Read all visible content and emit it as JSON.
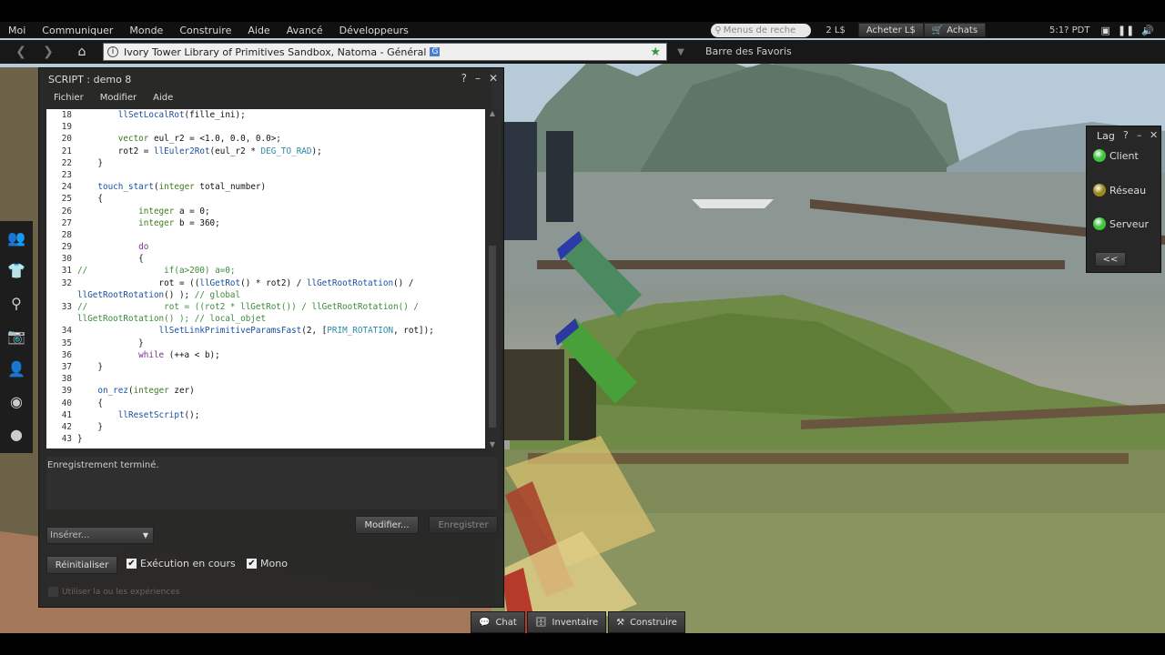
{
  "menubar": {
    "items": [
      "Moi",
      "Communiquer",
      "Monde",
      "Construire",
      "Aide",
      "Avancé",
      "Développeurs"
    ],
    "search_placeholder": "Menus de reche",
    "balance": "2 L$",
    "buy_button": "Acheter L$",
    "shop_button": "Achats",
    "clock": "5:1? PDT"
  },
  "navbar": {
    "location": "Ivory Tower Library of Primitives Sandbox, Natoma - Général",
    "favorites_label": "Barre des Favoris"
  },
  "script_window": {
    "title": "SCRIPT : demo 8",
    "menu": [
      "Fichier",
      "Modifier",
      "Aide"
    ],
    "code_lines": [
      {
        "n": "18",
        "html": "        <span class=\"fn\">llSetLocalRot</span>(fille_ini);"
      },
      {
        "n": "19",
        "html": ""
      },
      {
        "n": "20",
        "html": "        <span class=\"ty\">vector</span> eul_r2 = &lt;1.0, 0.0, 0.0&gt;;"
      },
      {
        "n": "21",
        "html": "        rot2 = <span class=\"fn\">llEuler2Rot</span>(eul_r2 * <span class=\"cst\">DEG_TO_RAD</span>);"
      },
      {
        "n": "22",
        "html": "    }"
      },
      {
        "n": "23",
        "html": ""
      },
      {
        "n": "24",
        "html": "    <span class=\"fn\">touch_start</span>(<span class=\"ty\">integer</span> total_number)"
      },
      {
        "n": "25",
        "html": "    {"
      },
      {
        "n": "26",
        "html": "            <span class=\"ty\">integer</span> a = 0;"
      },
      {
        "n": "27",
        "html": "            <span class=\"ty\">integer</span> b = 360;"
      },
      {
        "n": "28",
        "html": ""
      },
      {
        "n": "29",
        "html": "            <span class=\"kw\">do</span>"
      },
      {
        "n": "30",
        "html": "            {"
      },
      {
        "n": "31",
        "html": "<span class=\"cm\">//               if(a&gt;200) a=0;</span>"
      },
      {
        "n": "32",
        "html": "                rot = ((<span class=\"fn\">llGetRot</span>() * rot2) / <span class=\"fn\">llGetRootRotation</span>() /"
      },
      {
        "n": "",
        "html": "<span class=\"fn\">llGetRootRotation</span>() ); <span class=\"cm\">// global</span>"
      },
      {
        "n": "33",
        "html": "<span class=\"cm\">//               rot = ((rot2 * llGetRot()) / llGetRootRotation() /</span>"
      },
      {
        "n": "",
        "html": "<span class=\"cm\">llGetRootRotation() ); // local_objet</span>"
      },
      {
        "n": "34",
        "html": "                <span class=\"fn\">llSetLinkPrimitiveParamsFast</span>(2, [<span class=\"cst\">PRIM_ROTATION</span>, rot]);"
      },
      {
        "n": "35",
        "html": "            }"
      },
      {
        "n": "36",
        "html": "            <span class=\"kw\">while</span> (++a &lt; b);"
      },
      {
        "n": "37",
        "html": "    }"
      },
      {
        "n": "38",
        "html": ""
      },
      {
        "n": "39",
        "html": "    <span class=\"fn\">on_rez</span>(<span class=\"ty\">integer</span> zer)"
      },
      {
        "n": "40",
        "html": "    {"
      },
      {
        "n": "41",
        "html": "        <span class=\"fn\">llResetScript</span>();"
      },
      {
        "n": "42",
        "html": "    }"
      },
      {
        "n": "43",
        "html": "}"
      }
    ],
    "status": "Enregistrement terminé.",
    "insert_label": "Insérer...",
    "edit_button": "Modifier...",
    "save_button": "Enregistrer",
    "reset_button": "Réinitialiser",
    "running_label": "Exécution en cours",
    "mono_label": "Mono",
    "experience_label": "Utiliser la ou les expériences"
  },
  "lag_meter": {
    "title": "Lag",
    "rows": [
      {
        "label": "Client",
        "color": "#3ec43e"
      },
      {
        "label": "Réseau",
        "color": "#9a8a1e"
      },
      {
        "label": "Serveur",
        "color": "#3ec43e"
      }
    ],
    "collapse": "<<"
  },
  "bottom_bar": {
    "buttons": [
      "Chat",
      "Inventaire",
      "Construire"
    ]
  }
}
